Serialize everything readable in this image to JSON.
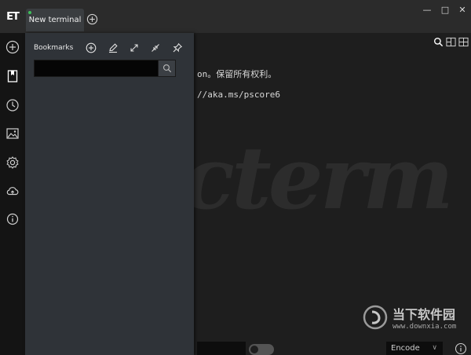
{
  "titlebar": {
    "logo_text": "ET",
    "tab_label": "New terminal",
    "window_buttons": {
      "minimize": "—",
      "maximize": "□",
      "close": "✕"
    }
  },
  "sidebar": {
    "icons": [
      "add-icon",
      "bookmark-icon",
      "history-icon",
      "image-icon",
      "settings-icon",
      "cloud-sync-icon",
      "info-icon"
    ]
  },
  "panel": {
    "title": "Bookmarks",
    "search_value": "",
    "buttons": [
      "add-icon",
      "edit-icon",
      "expand-icon",
      "collapse-icon",
      "pin-icon"
    ]
  },
  "terminal": {
    "lines": [
      "on。保留所有权利。",
      "//aka.ms/pscore6"
    ],
    "watermark_text": "cterm",
    "encode_value": "Encode",
    "encode_chevron": "∨",
    "toolbar_icons": [
      "search-icon",
      "split-horizontal-icon",
      "split-grid-icon"
    ]
  },
  "site_watermark": {
    "title": "当下软件园",
    "url": "www.downxia.com"
  },
  "colors": {
    "titlebar": "#2b2b2b",
    "sidebar": "#141414",
    "panel": "#2f3338",
    "terminal": "#1e1e1e",
    "tab_dot": "#3fbf5a"
  }
}
